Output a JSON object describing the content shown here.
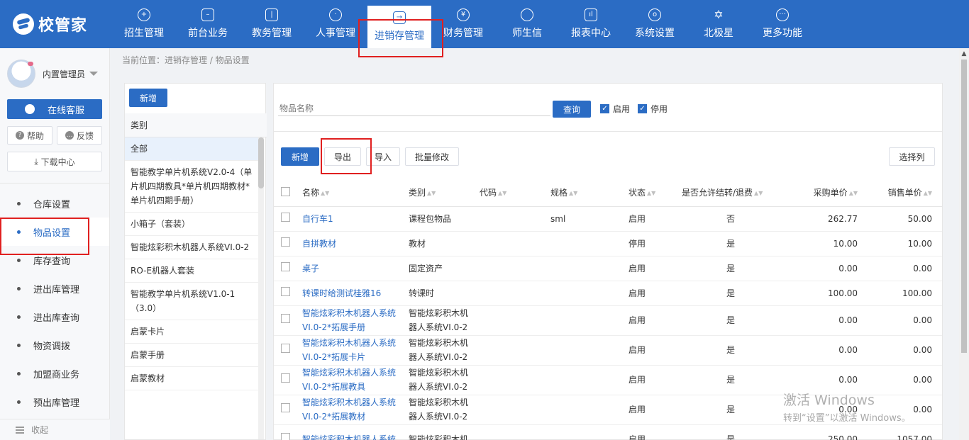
{
  "brand": {
    "name": "校管家"
  },
  "nav": [
    {
      "label": "招生管理",
      "icon": "person-plus-icon"
    },
    {
      "label": "前台业务",
      "icon": "monitor-icon"
    },
    {
      "label": "教务管理",
      "icon": "book-icon"
    },
    {
      "label": "人事管理",
      "icon": "person-icon"
    },
    {
      "label": "进销存管理",
      "icon": "inventory-icon"
    },
    {
      "label": "财务管理",
      "icon": "yuan-icon"
    },
    {
      "label": "师生信",
      "icon": "chat-icon"
    },
    {
      "label": "报表中心",
      "icon": "chart-icon"
    },
    {
      "label": "系统设置",
      "icon": "settings-icon"
    },
    {
      "label": "北极星",
      "icon": "star-icon"
    },
    {
      "label": "更多功能",
      "icon": "more-icon"
    }
  ],
  "sidebar": {
    "user_name": "内置管理员",
    "service_button": "在线客服",
    "help": "帮助",
    "feedback": "反馈",
    "download": "下载中心",
    "menu": [
      "仓库设置",
      "物品设置",
      "库存查询",
      "进出库管理",
      "进出库查询",
      "物资调拨",
      "加盟商业务",
      "预出库管理"
    ],
    "collapse": "收起"
  },
  "breadcrumb": "当前位置：进销存管理 / 物品设置",
  "category": {
    "add_label": "新增",
    "header": "类别",
    "items": [
      "全部",
      "智能教学单片机系统V2.0-4（单片机四期教具*单片机四期教材*单片机四期手册）",
      "小箱子（套装）",
      "智能炫彩积木机器人系统VI.0-2",
      "RO-E机器人套装",
      "智能教学单片机系统V1.0-1（3.0）",
      "启蒙卡片",
      "启蒙手册",
      "启蒙教材"
    ]
  },
  "search": {
    "placeholder": "物品名称",
    "button": "查询",
    "enabled_label": "启用",
    "disabled_label": "停用"
  },
  "toolbar": {
    "add": "新增",
    "export": "导出",
    "import": "导入",
    "batch_edit": "批量修改",
    "select_columns": "选择列"
  },
  "table": {
    "headers": [
      "名称",
      "类别",
      "代码",
      "规格",
      "状态",
      "是否允许结转/退费",
      "采购单价",
      "销售单价"
    ],
    "rows": [
      {
        "name": "自行车1",
        "category": "课程包物品",
        "code": "",
        "spec": "sml",
        "status": "启用",
        "refund": "否",
        "purchase": "262.77",
        "sale": "50.00"
      },
      {
        "name": "自拼教材",
        "category": "教材",
        "code": "",
        "spec": "",
        "status": "停用",
        "refund": "是",
        "purchase": "10.00",
        "sale": "10.00"
      },
      {
        "name": "桌子",
        "category": "固定资产",
        "code": "",
        "spec": "",
        "status": "启用",
        "refund": "是",
        "purchase": "0.00",
        "sale": "0.00"
      },
      {
        "name": "转课时给测试桂雅16",
        "category": "转课时",
        "code": "",
        "spec": "",
        "status": "启用",
        "refund": "是",
        "purchase": "100.00",
        "sale": "100.00"
      },
      {
        "name": "智能炫彩积木机器人系统VI.0-2*拓展手册",
        "category": "智能炫彩积木机器人系统VI.0-2",
        "code": "",
        "spec": "",
        "status": "启用",
        "refund": "是",
        "purchase": "0.00",
        "sale": "0.00"
      },
      {
        "name": "智能炫彩积木机器人系统VI.0-2*拓展卡片",
        "category": "智能炫彩积木机器人系统VI.0-2",
        "code": "",
        "spec": "",
        "status": "启用",
        "refund": "是",
        "purchase": "0.00",
        "sale": "0.00"
      },
      {
        "name": "智能炫彩积木机器人系统VI.0-2*拓展教具",
        "category": "智能炫彩积木机器人系统VI.0-2",
        "code": "",
        "spec": "",
        "status": "启用",
        "refund": "是",
        "purchase": "0.00",
        "sale": "0.00"
      },
      {
        "name": "智能炫彩积木机器人系统VI.0-2*拓展教材",
        "category": "智能炫彩积木机器人系统VI.0-2",
        "code": "",
        "spec": "",
        "status": "启用",
        "refund": "是",
        "purchase": "0.00",
        "sale": "0.00"
      },
      {
        "name": "智能炫彩积木机器人系统",
        "category": "智能炫彩积木机",
        "code": "",
        "spec": "",
        "status": "启用",
        "refund": "是",
        "purchase": "250.00",
        "sale": "1057.00"
      }
    ]
  },
  "watermark": {
    "line1": "激活 Windows",
    "line2": "转到“设置”以激活 Windows。"
  }
}
